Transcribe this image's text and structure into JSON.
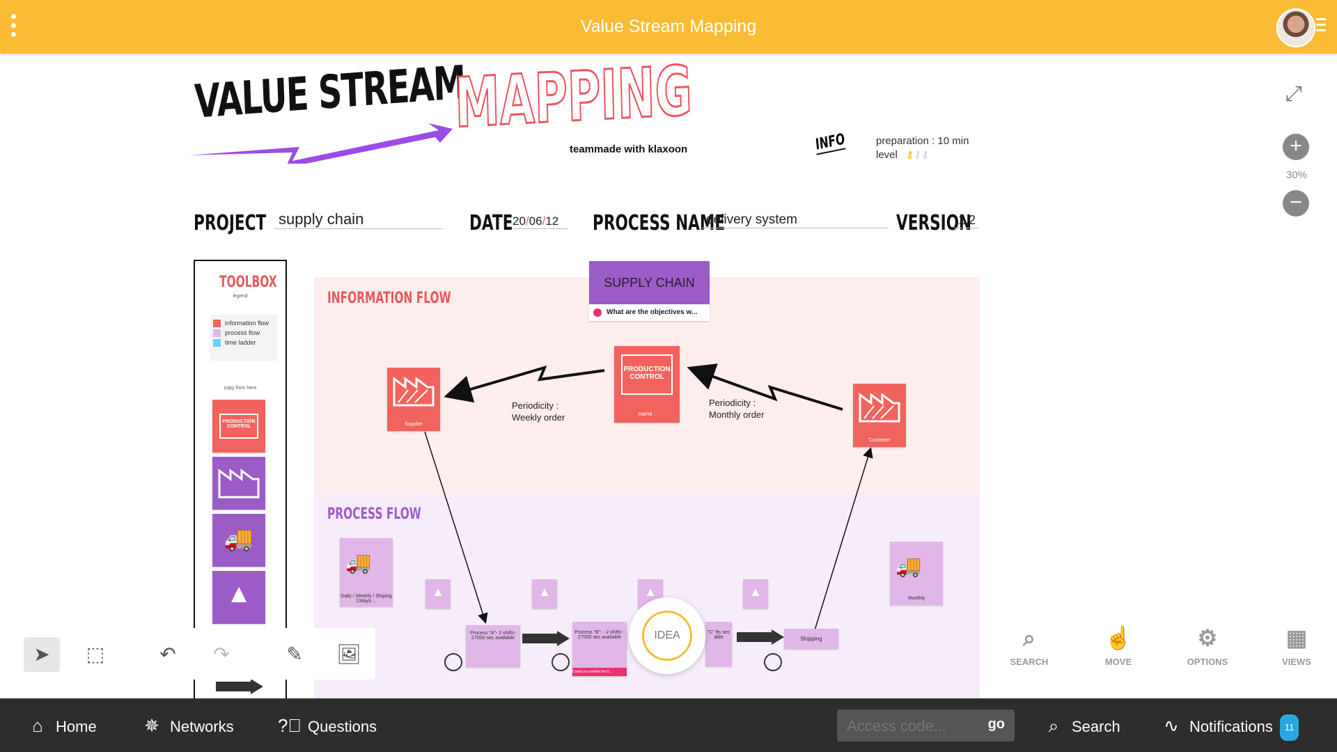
{
  "topbar": {
    "title": "Value Stream Mapping"
  },
  "header": {
    "title_part1": "VALUE STREAM",
    "title_part2": "MAPPING",
    "tagline": "teammade with klaxoon",
    "info": "INFO",
    "preparation": "preparation : 10 min",
    "level": "level"
  },
  "form": {
    "project_label": "PROJECT",
    "project_value": "supply chain",
    "date_label": "DATE",
    "date_day": "20",
    "date_month": "06",
    "date_year": "12",
    "process_label": "PROCESS NAME",
    "process_value": "delivery system",
    "version_label": "VERSION",
    "version_value": "1.2"
  },
  "zoom": {
    "level": "30%",
    "plus": "+",
    "minus": "−"
  },
  "tools": {
    "search": "SEARCH",
    "move": "MOVE",
    "options": "OPTIONS",
    "views": "VIEWS"
  },
  "toolbox": {
    "title": "TOOLBOX",
    "subtitle": "legend",
    "legend": [
      "information flow",
      "process flow",
      "time ladder"
    ],
    "copy": "copy from here",
    "production_control": "PRODUCTION CONTROL"
  },
  "board": {
    "info_flow": "INFORMATION FLOW",
    "process_flow": "PROCESS FLOW",
    "supply_chain": "SUPPLY CHAIN",
    "question": "What are the objectives w...",
    "production_control": "PRODUCTION CONTROL",
    "name_label": "name :",
    "supplier": "Supplier",
    "customer": "Customer",
    "periodicity_weekly_1": "Periodicity :",
    "periodicity_weekly_2": "Weekly order",
    "periodicity_monthly_1": "Periodicity :",
    "periodicity_monthly_2": "Monthly order",
    "daily_shipping": "Daily / Weekly / Shiping 13days ...",
    "monthly": "Monthly",
    "process_a": "Process \"A\"- 2 shifts- 27000 sec available",
    "process_b": "Process \"B\": - 2 shifts - 27000 sec available",
    "process_c": "\"C\" fts sec able",
    "shipping": "Shipping",
    "question_b": "Could you confirm the ti...",
    "idea": "IDEA"
  },
  "colors": {
    "accent": "#FBBC35",
    "info_flow": "#F3635E",
    "process_flow": "#9B5CC8",
    "nav_bg": "#2D2D2D",
    "badge": "#28A8E0"
  },
  "nav": {
    "home": "Home",
    "networks": "Networks",
    "questions": "Questions",
    "access_placeholder": "Access code...",
    "go": "go",
    "search": "Search",
    "notifications": "Notifications",
    "notif_count": "11"
  },
  "icons": [
    "menu-dots-icon",
    "hamburger-icon",
    "fullscreen-icon",
    "search-icon",
    "move-icon",
    "options-icon",
    "views-icon",
    "cursor-icon",
    "select-icon",
    "undo-icon",
    "redo-icon",
    "note-icon",
    "image-icon",
    "home-icon",
    "networks-icon",
    "questions-icon",
    "notifications-icon"
  ]
}
